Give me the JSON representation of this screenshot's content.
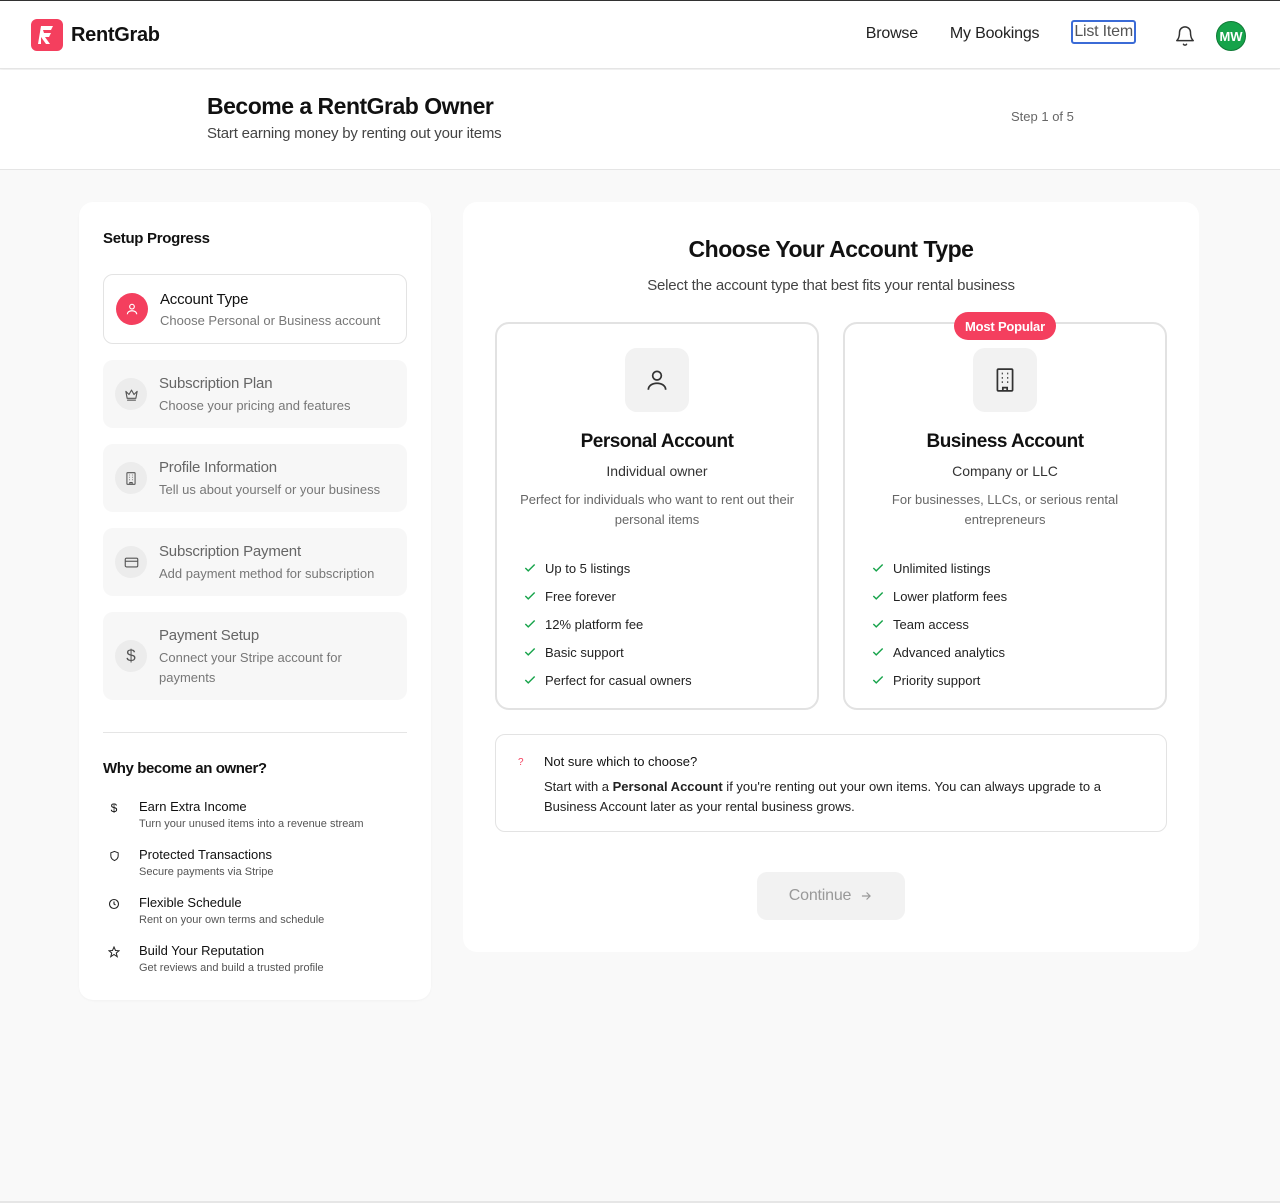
{
  "brand": {
    "name": "RentGrab",
    "accent": "#f43f5e"
  },
  "nav": {
    "links": [
      "Browse",
      "My Bookings",
      "List Item"
    ],
    "active": "List Item",
    "avatar_initials": "MW",
    "notification_icon": "bell-icon"
  },
  "page": {
    "title": "Become a RentGrab Owner",
    "subtitle": "Start earning money by renting out your items",
    "step": "Step 1 of 5"
  },
  "sidebar": {
    "title": "Setup Progress",
    "steps": [
      {
        "name": "Account Type",
        "desc": "Choose Personal or Business account",
        "icon": "user-icon",
        "current": true
      },
      {
        "name": "Subscription Plan",
        "desc": "Choose your pricing and features",
        "icon": "crown-icon"
      },
      {
        "name": "Profile Information",
        "desc": "Tell us about yourself or your business",
        "icon": "building-icon"
      },
      {
        "name": "Subscription Payment",
        "desc": "Add payment method for subscription",
        "icon": "credit-card-icon"
      },
      {
        "name": "Payment Setup",
        "desc": "Connect your Stripe account for payments",
        "icon": "dollar-icon"
      }
    ],
    "why_title": "Why become an owner?",
    "benefits": [
      {
        "name": "Earn Extra Income",
        "desc": "Turn your unused items into a revenue stream",
        "icon": "dollar-icon"
      },
      {
        "name": "Protected Transactions",
        "desc": "Secure payments via Stripe",
        "icon": "shield-icon"
      },
      {
        "name": "Flexible Schedule",
        "desc": "Rent on your own terms and schedule",
        "icon": "clock-icon"
      },
      {
        "name": "Build Your Reputation",
        "desc": "Get reviews and build a trusted profile",
        "icon": "star-icon"
      }
    ]
  },
  "main": {
    "title": "Choose Your Account Type",
    "subtitle": "Select the account type that best fits your rental business",
    "badge": "Most Popular",
    "cards": [
      {
        "title": "Personal Account",
        "kind": "Individual owner",
        "desc": "Perfect for individuals who want to rent out their personal items",
        "icon": "user-icon",
        "features": [
          "Up to 5 listings",
          "Free forever",
          "12% platform fee",
          "Basic support",
          "Perfect for casual owners"
        ]
      },
      {
        "title": "Business Account",
        "kind": "Company or LLC",
        "desc": "For businesses, LLCs, or serious rental entrepreneurs",
        "icon": "building-icon",
        "features": [
          "Unlimited listings",
          "Lower platform fees",
          "Team access",
          "Advanced analytics",
          "Priority support"
        ]
      }
    ],
    "tip": {
      "icon": "?",
      "title": "Not sure which to choose?",
      "text_before": "Start with a ",
      "text_bold": "Personal Account",
      "text_after": " if you're renting out your own items. You can always upgrade to a Business Account later as your rental business grows."
    },
    "continue_label": "Continue"
  },
  "colors": {
    "success": "#16a34a",
    "accent": "#f43f5e"
  }
}
